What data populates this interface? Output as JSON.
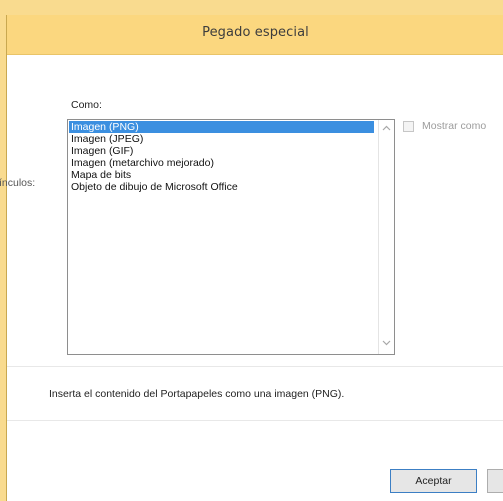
{
  "dialog": {
    "title": "Pegado especial",
    "vinculos_label": "ínculos:",
    "como_label": "Como:",
    "list_items": [
      "Imagen (PNG)",
      "Imagen (JPEG)",
      "Imagen (GIF)",
      "Imagen (metarchivo mejorado)",
      "Mapa de bits",
      "Objeto de dibujo de Microsoft Office"
    ],
    "selected_index": 0,
    "show_as_icon_label": "Mostrar como",
    "description": "Inserta el contenido del Portapapeles como una imagen (PNG).",
    "accept_label": "Aceptar"
  },
  "colors": {
    "titlebar": "#fbd77f",
    "background": "#f9db8f",
    "selection": "#3b8fe0",
    "accept_border": "#3c7fc4"
  },
  "icons": {
    "scroll_up": "chevron-up-icon",
    "scroll_down": "chevron-down-icon"
  }
}
